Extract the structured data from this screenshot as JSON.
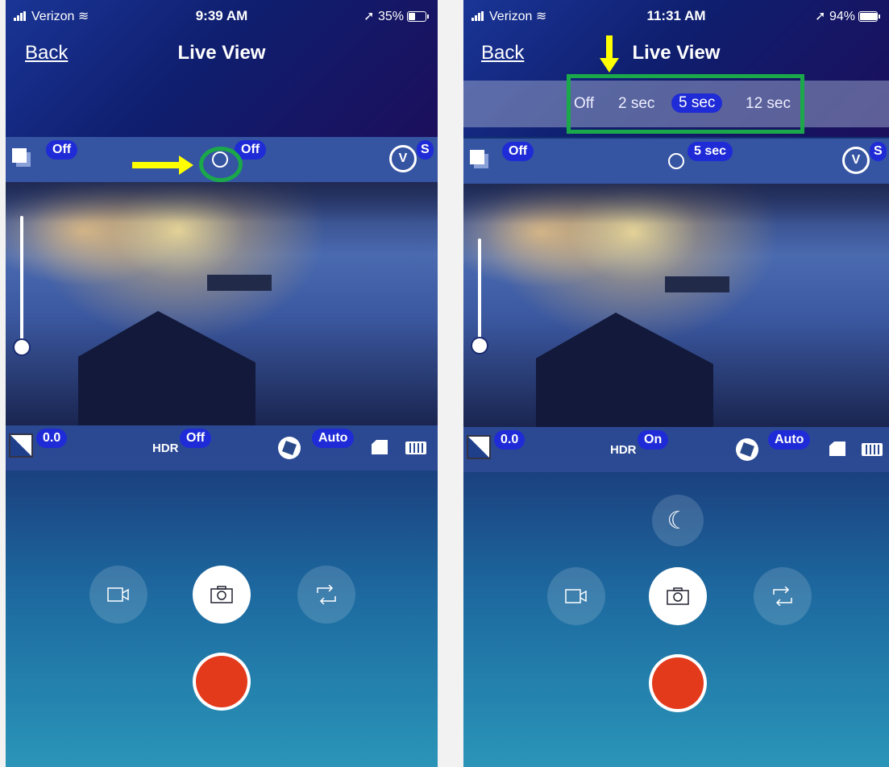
{
  "left": {
    "status": {
      "carrier": "Verizon",
      "time": "9:39 AM",
      "battery": "35%"
    },
    "nav": {
      "back": "Back",
      "title": "Live View"
    },
    "top_toolbar": {
      "drive_mode": "Off",
      "self_timer": "Off",
      "shooting_mode": "S"
    },
    "bottom_toolbar": {
      "exposure_comp": "0.0",
      "hdr_label": "HDR",
      "hdr_value": "Off",
      "white_balance": "Auto"
    },
    "controls": {
      "video": "video-camera",
      "photo": "camera",
      "switch": "switch"
    }
  },
  "right": {
    "status": {
      "carrier": "Verizon",
      "time": "11:31 AM",
      "battery": "94%"
    },
    "nav": {
      "back": "Back",
      "title": "Live View"
    },
    "timer_options": [
      "Off",
      "2 sec",
      "5 sec",
      "12 sec"
    ],
    "timer_selected": "5 sec",
    "top_toolbar": {
      "drive_mode": "Off",
      "self_timer": "5 sec",
      "shooting_mode": "S"
    },
    "bottom_toolbar": {
      "exposure_comp": "0.0",
      "hdr_label": "HDR",
      "hdr_value": "On",
      "white_balance": "Auto"
    },
    "controls": {
      "night": "moon",
      "video": "video-camera",
      "photo": "camera",
      "switch": "switch"
    }
  },
  "colors": {
    "pill": "#1f2bd6",
    "annotation_green": "#1aa84a",
    "annotation_yellow": "#ffff00",
    "record": "#e33a1c"
  }
}
